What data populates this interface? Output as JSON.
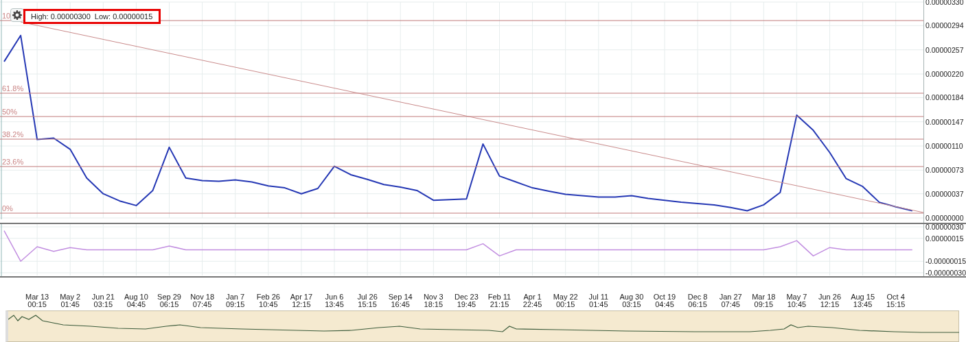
{
  "price_range": {
    "high_label": "High: 0.00000300",
    "low_label": "Low: 0.00000015"
  },
  "fib_labels": [
    "10",
    "61.8%",
    "50%",
    "38.2%",
    "23.6%",
    "0%"
  ],
  "price_chart": {
    "chart_data": {
      "type": "line",
      "grid": true,
      "ylim": [
        0,
        3.3e-06
      ],
      "yticks": [
        {
          "value": 3.3e-06,
          "label": "0.00000330"
        },
        {
          "value": 2.94e-06,
          "label": "0.00000294"
        },
        {
          "value": 2.57e-06,
          "label": "0.00000257"
        },
        {
          "value": 2.2e-06,
          "label": "0.00000220"
        },
        {
          "value": 1.84e-06,
          "label": "0.00000184"
        },
        {
          "value": 1.47e-06,
          "label": "0.00000147"
        },
        {
          "value": 1.1e-06,
          "label": "0.00000110"
        },
        {
          "value": 7.3e-07,
          "label": "0.00000073"
        },
        {
          "value": 3.7e-07,
          "label": "0.00000037"
        },
        {
          "value": 0,
          "label": "0.00000000"
        }
      ],
      "categories": [
        null,
        null,
        null,
        null,
        null,
        null,
        null,
        null,
        null,
        null,
        null,
        null,
        null,
        null,
        null,
        null,
        null,
        null,
        null,
        null,
        null,
        null,
        null,
        null,
        null,
        null,
        null,
        null,
        null,
        null,
        null,
        null,
        null,
        null,
        null,
        null,
        null,
        null,
        null,
        null,
        null,
        null,
        null,
        null,
        null,
        null,
        null,
        null,
        null,
        null,
        null,
        null,
        null,
        null,
        null,
        null
      ],
      "series": [
        {
          "color": "#2437b4",
          "values": [
            2.39e-06,
            2.79e-06,
            1.2e-06,
            1.22e-06,
            1.05e-06,
            6.1e-07,
            3.7e-07,
            2.6e-07,
            1.9e-07,
            4.2e-07,
            1.08e-06,
            6.1e-07,
            5.7e-07,
            5.6e-07,
            5.8e-07,
            5.5e-07,
            4.9e-07,
            4.6e-07,
            3.7e-07,
            4.5e-07,
            7.9e-07,
            6.6e-07,
            5.9e-07,
            5.1e-07,
            4.7e-07,
            4.2e-07,
            2.7e-07,
            2.8e-07,
            2.9e-07,
            1.13e-06,
            6.4e-07,
            5.5e-07,
            4.6e-07,
            4.1e-07,
            3.6e-07,
            3.4e-07,
            3.2e-07,
            3.2e-07,
            3.4e-07,
            3e-07,
            2.7e-07,
            2.4e-07,
            2.2e-07,
            2e-07,
            1.6e-07,
            1.1e-07,
            2e-07,
            3.9e-07,
            1.57e-06,
            1.34e-06,
            1e-06,
            6e-07,
            4.8e-07,
            2.4e-07,
            1.7e-07,
            1.1e-07
          ]
        }
      ]
    }
  },
  "oscillator_chart": {
    "chart_data": {
      "type": "line",
      "grid": true,
      "ylim": [
        -3.36e-07,
        3.36e-07
      ],
      "yticks": [
        {
          "value": 3e-07,
          "label": "0.00000030"
        },
        {
          "value": 1.5e-07,
          "label": "0.00000015"
        },
        {
          "value": -1.5e-07,
          "label": "-0.00000015"
        },
        {
          "value": -3e-07,
          "label": "-0.00000030"
        }
      ],
      "categories": [
        null,
        null,
        "Mar 13\n00:15",
        null,
        "May 2\n01:45",
        null,
        "Jun 21\n03:15",
        null,
        "Aug 10\n04:45",
        null,
        "Sep 29\n06:15",
        null,
        "Nov 18\n07:45",
        null,
        "Jan 7\n09:15",
        null,
        "Feb 26\n10:45",
        null,
        "Apr 17\n12:15",
        null,
        "Jun 6\n13:45",
        null,
        "Jul 26\n15:15",
        null,
        "Sep 14\n16:45",
        null,
        "Nov 3\n18:15",
        null,
        "Dec 23\n19:45",
        null,
        "Feb 11\n21:15",
        null,
        "Apr 1\n22:45",
        null,
        "May 22\n00:15",
        null,
        "Jul 11\n01:45",
        null,
        "Aug 30\n03:15",
        null,
        "Oct 19\n04:45",
        null,
        "Dec 8\n06:15",
        null,
        "Jan 27\n07:45",
        null,
        "Mar 18\n09:15",
        null,
        "May 7\n10:45",
        null,
        "Jun 26\n12:15",
        null,
        "Aug 15\n13:45",
        null,
        "Oct 4\n15:15",
        null
      ],
      "series": [
        {
          "color": "#c28ee0",
          "values": [
            2.5e-07,
            -1.5e-07,
            4e-08,
            -2e-08,
            3e-08,
            0,
            0,
            0,
            0,
            0,
            5e-08,
            0,
            0,
            0,
            0,
            0,
            0,
            0,
            0,
            0,
            0,
            0,
            0,
            0,
            0,
            0,
            0,
            0,
            0,
            8e-08,
            -8e-08,
            0,
            0,
            0,
            0,
            0,
            0,
            0,
            0,
            0,
            0,
            0,
            0,
            0,
            0,
            0,
            0,
            4e-08,
            1.2e-07,
            -8e-08,
            3e-08,
            0,
            0,
            0,
            0,
            0
          ]
        }
      ]
    }
  }
}
